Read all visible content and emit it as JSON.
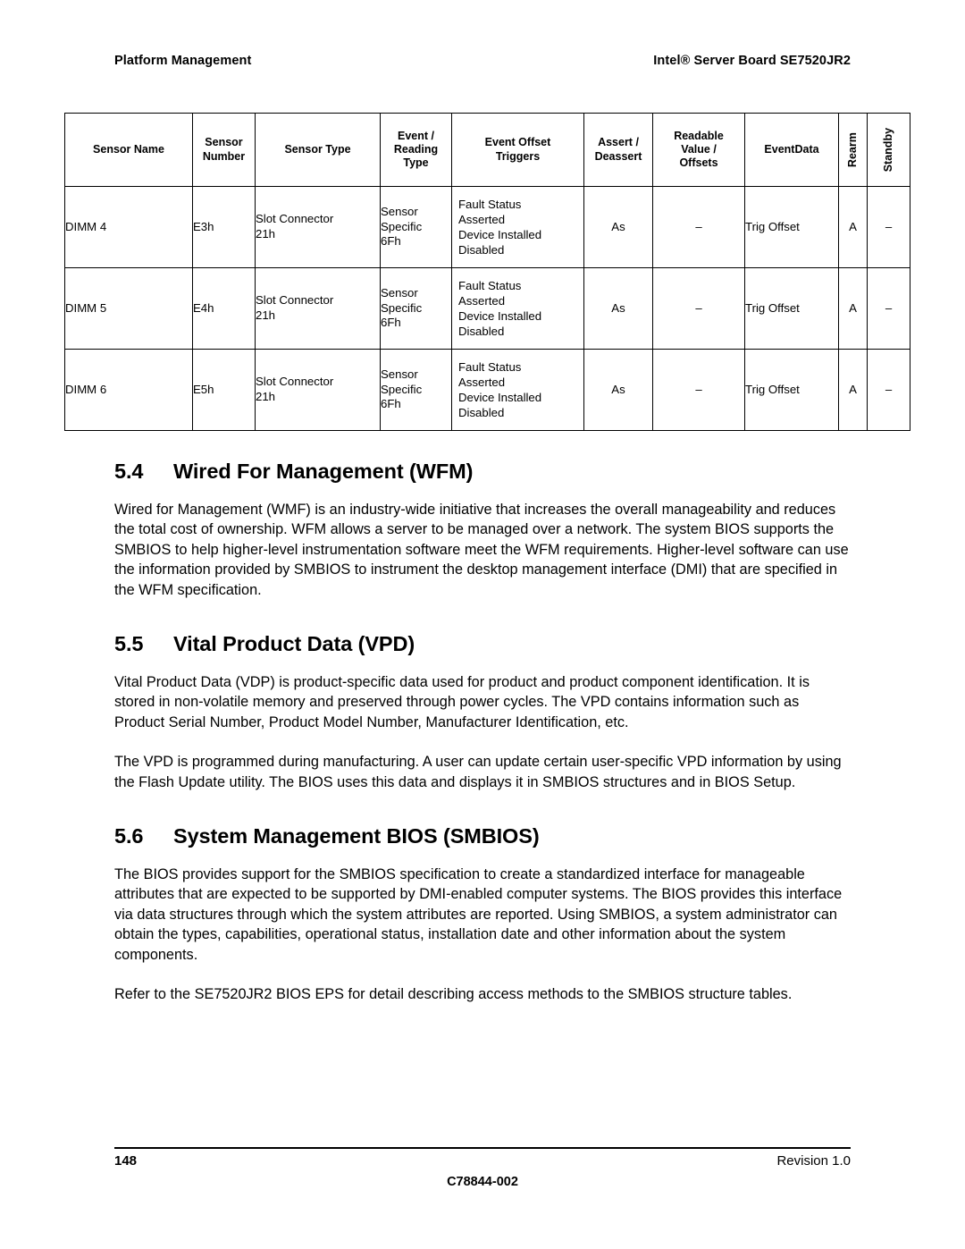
{
  "header": {
    "left": "Platform Management",
    "right": "Intel® Server Board SE7520JR2"
  },
  "sensor_table": {
    "columns": [
      "Sensor Name",
      "Sensor\nNumber",
      "Sensor Type",
      "Event /\nReading\nType",
      "Event Offset\nTriggers",
      "Assert /\nDeassert",
      "Readable\nValue /\nOffsets",
      "EventData",
      "Rearm",
      "Standby"
    ],
    "headers": {
      "sensor_name": "Sensor Name",
      "sensor_number_l1": "Sensor",
      "sensor_number_l2": "Number",
      "sensor_type": "Sensor Type",
      "event_reading_l1": "Event /",
      "event_reading_l2": "Reading",
      "event_reading_l3": "Type",
      "event_offset_l1": "Event Offset",
      "event_offset_l2": "Triggers",
      "assert_l1": "Assert /",
      "assert_l2": "Deassert",
      "readable_l1": "Readable",
      "readable_l2": "Value /",
      "readable_l3": "Offsets",
      "eventdata": "EventData",
      "rearm": "Rearm",
      "standby": "Standby"
    },
    "rows": [
      {
        "sensor_name": "DIMM 4",
        "sensor_number": "E3h",
        "sensor_type_l1": "Slot Connector",
        "sensor_type_l2": "21h",
        "event_reading_l1": "Sensor",
        "event_reading_l2": "Specific",
        "event_reading_l3": "6Fh",
        "triggers": [
          "Fault Status",
          "Asserted",
          "Device Installed",
          "Disabled"
        ],
        "assert_deassert": "As",
        "readable_value": "–",
        "eventdata": "Trig Offset",
        "rearm": "A",
        "standby": "–"
      },
      {
        "sensor_name": "DIMM 5",
        "sensor_number": "E4h",
        "sensor_type_l1": "Slot Connector",
        "sensor_type_l2": "21h",
        "event_reading_l1": "Sensor",
        "event_reading_l2": "Specific",
        "event_reading_l3": "6Fh",
        "triggers": [
          "Fault Status",
          "Asserted",
          "Device Installed",
          "Disabled"
        ],
        "assert_deassert": "As",
        "readable_value": "–",
        "eventdata": "Trig Offset",
        "rearm": "A",
        "standby": "–"
      },
      {
        "sensor_name": "DIMM 6",
        "sensor_number": "E5h",
        "sensor_type_l1": "Slot Connector",
        "sensor_type_l2": "21h",
        "event_reading_l1": "Sensor",
        "event_reading_l2": "Specific",
        "event_reading_l3": "6Fh",
        "triggers": [
          "Fault Status",
          "Asserted",
          "Device Installed",
          "Disabled"
        ],
        "assert_deassert": "As",
        "readable_value": "–",
        "eventdata": "Trig Offset",
        "rearm": "A",
        "standby": "–"
      }
    ]
  },
  "sections": {
    "s54": {
      "number": "5.4",
      "title": "Wired For Management (WFM)",
      "paragraphs": [
        "Wired for Management (WMF) is an industry-wide initiative that increases the overall manageability and reduces the total cost of ownership. WFM allows a server to be managed over a network. The system BIOS supports the SMBIOS to help higher-level instrumentation software meet the WFM requirements. Higher-level software can use the information provided by SMBIOS to instrument the desktop management interface (DMI) that are specified in the WFM specification."
      ]
    },
    "s55": {
      "number": "5.5",
      "title": "Vital Product Data (VPD)",
      "paragraphs": [
        "Vital Product Data (VDP) is product-specific data used for product and product component identification. It is stored in non-volatile memory and preserved through power cycles. The VPD contains information such as Product Serial Number, Product Model Number, Manufacturer Identification, etc.",
        "The VPD is programmed during manufacturing. A user can update certain user-specific VPD information by using the Flash Update utility. The BIOS uses this data and displays it in SMBIOS structures and in BIOS Setup."
      ]
    },
    "s56": {
      "number": "5.6",
      "title": "System Management BIOS (SMBIOS)",
      "paragraphs": [
        "The BIOS provides support for the SMBIOS specification to create a standardized interface for manageable attributes that are expected to be supported by DMI-enabled computer systems. The BIOS provides this interface via data structures through which the system attributes are reported.  Using SMBIOS, a system administrator can obtain the types, capabilities, operational status, installation date and other information about the system components.",
        "Refer to the SE7520JR2 BIOS EPS for detail describing access methods to the SMBIOS structure tables."
      ]
    }
  },
  "footer": {
    "page_number": "148",
    "revision": "Revision 1.0",
    "document_number": "C78844-002"
  }
}
